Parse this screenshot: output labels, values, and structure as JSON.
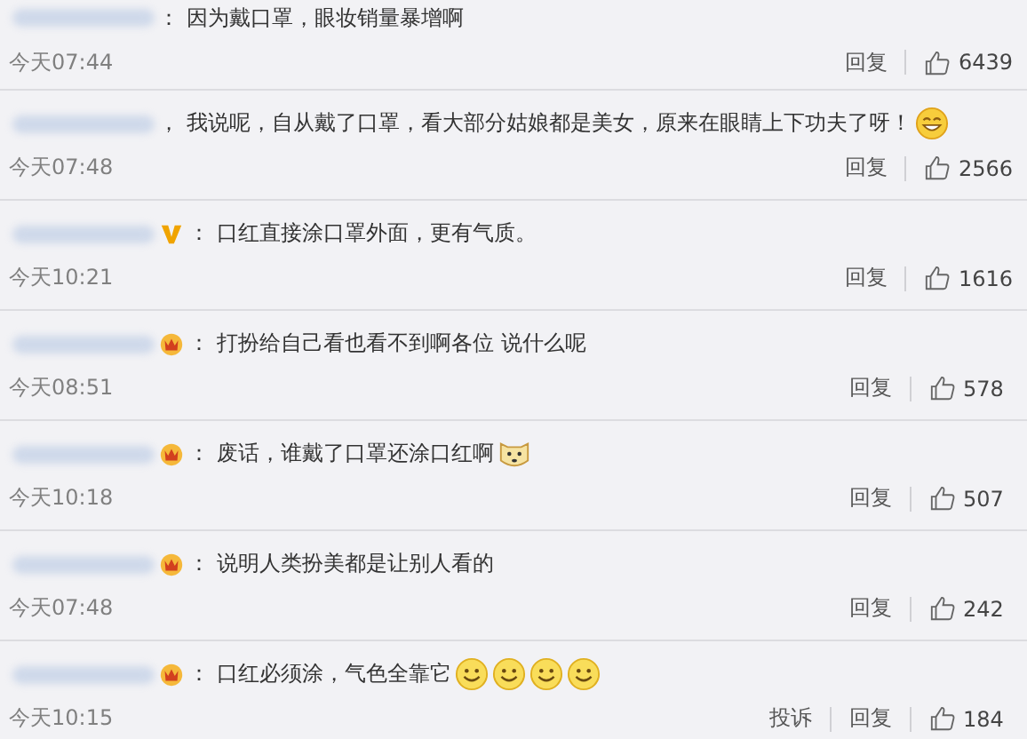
{
  "comments": [
    {
      "colon": "：",
      "text": "因为戴口罩，眼妆销量暴增啊",
      "time": "今天07:44",
      "actions": [
        "回复"
      ],
      "likes": "6439"
    },
    {
      "colon": "，",
      "text": "我说呢，自从戴了口罩，看大部分姑娘都是美女，原来在眼睛上下功夫了呀！",
      "emojis": [
        {
          "kind": "grin"
        }
      ],
      "time": "今天07:48",
      "actions": [
        "回复"
      ],
      "likes": "2566"
    },
    {
      "badge": {
        "kind": "verified"
      },
      "colon": "：",
      "text": "口红直接涂口罩外面，更有气质。",
      "time": "今天10:21",
      "actions": [
        "回复"
      ],
      "likes": "1616"
    },
    {
      "badge": {
        "kind": "crown"
      },
      "colon": "：",
      "text": "打扮给自己看也看不到啊各位 说什么呢",
      "time": "今天08:51",
      "actions": [
        "回复"
      ],
      "likes": "578"
    },
    {
      "badge": {
        "kind": "crown"
      },
      "colon": "：",
      "text": "废话，谁戴了口罩还涂口红啊",
      "emojis": [
        {
          "kind": "cat"
        }
      ],
      "time": "今天10:18",
      "actions": [
        "回复"
      ],
      "likes": "507"
    },
    {
      "badge": {
        "kind": "crown"
      },
      "colon": "：",
      "text": "说明人类扮美都是让别人看的",
      "time": "今天07:48",
      "actions": [
        "回复"
      ],
      "likes": "242"
    },
    {
      "badge": {
        "kind": "crown"
      },
      "colon": "：",
      "text": "口红必须涂，气色全靠它",
      "emojis": [
        {
          "kind": "smile"
        },
        {
          "kind": "smile"
        },
        {
          "kind": "smile"
        },
        {
          "kind": "smile"
        }
      ],
      "time": "今天10:15",
      "actions": [
        "投诉",
        "回复"
      ],
      "likes": "184"
    }
  ]
}
